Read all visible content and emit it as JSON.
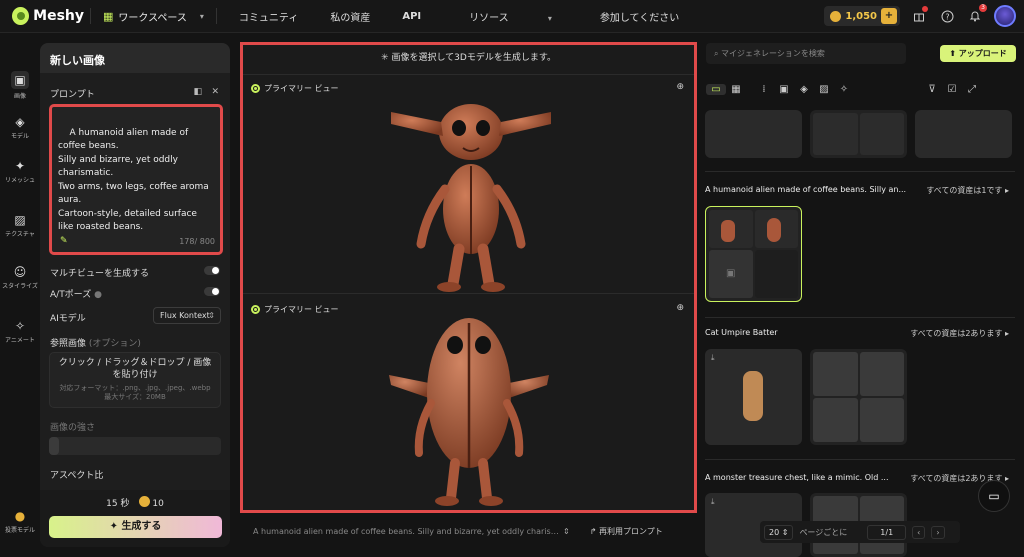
{
  "brand": {
    "name": "Meshy"
  },
  "topnav": {
    "workspace": "ワークスペース",
    "items": [
      "コミュニティ",
      "私の資産",
      "API",
      "リソース",
      "参加してください"
    ],
    "resources_caret": "▾",
    "credits": "1,050"
  },
  "notifications": {
    "count": "3"
  },
  "rail": [
    {
      "label": "画像",
      "icon": "image-icon"
    },
    {
      "label": "モデル",
      "icon": "cube-icon"
    },
    {
      "label": "リメッシュ",
      "icon": "remesh-icon"
    },
    {
      "label": "テクスチャ",
      "icon": "texture-icon"
    },
    {
      "label": "スタイライズ",
      "icon": "stylize-icon"
    },
    {
      "label": "アニメート",
      "icon": "animate-icon"
    },
    {
      "label": "投票モデル",
      "icon": "vote-icon"
    }
  ],
  "left": {
    "title": "新しい画像",
    "prompt_label": "プロンプト",
    "prompt_text": "A humanoid alien made of coffee beans.\nSilly and bizarre, yet oddly charismatic.\nTwo arms, two legs, coffee aroma aura.\nCartoon-style, detailed surface like roasted beans.",
    "prompt_count": "178/ 800",
    "multiview_label": "マルチビューを生成する",
    "pose_label": "A/Tポーズ",
    "ai_model_label": "AIモデル",
    "ai_model_value": "Flux Kontext",
    "ref_label": "参照画像",
    "ref_optional": "(オプション)",
    "drop_text": "クリック / ドラッグ＆ドロップ / 画像を貼り付け",
    "drop_formats": "対応フォーマット：.png、.jpg、.jpeg、.webp",
    "drop_maxsize": "最大サイズ：20MB",
    "strength_label": "画像の強さ",
    "aspect_label": "アスペクト比",
    "time": "15 秒",
    "cost": "10",
    "generate": "生成する"
  },
  "center": {
    "header": "画像を選択して3Dモデルを生成します。",
    "view_label": "プライマリー ビュー",
    "bottom_prompt": "A humanoid alien made of coffee beans. Silly and bizarre, yet oddly charism...",
    "reuse": "再利用プロンプト"
  },
  "right": {
    "search_placeholder": "マイジェネレーションを検索",
    "upload": "アップロード",
    "sections": [
      {
        "title": "A humanoid alien made of coffee beans. Silly an...",
        "all": "すべての資産は1です"
      },
      {
        "title": "Cat Umpire Batter",
        "all": "すべての資産は2あります"
      },
      {
        "title": "A monster treasure chest, like a mimic. Old ...",
        "all": "すべての資産は2あります"
      }
    ],
    "pager": {
      "per_page": "20",
      "per_page_label": "ページごとに",
      "page": "1/1"
    }
  },
  "colors": {
    "accent": "#c9f25d",
    "highlight": "#e04a4a",
    "coin": "#e6b13a",
    "bean": "#a9573a"
  }
}
